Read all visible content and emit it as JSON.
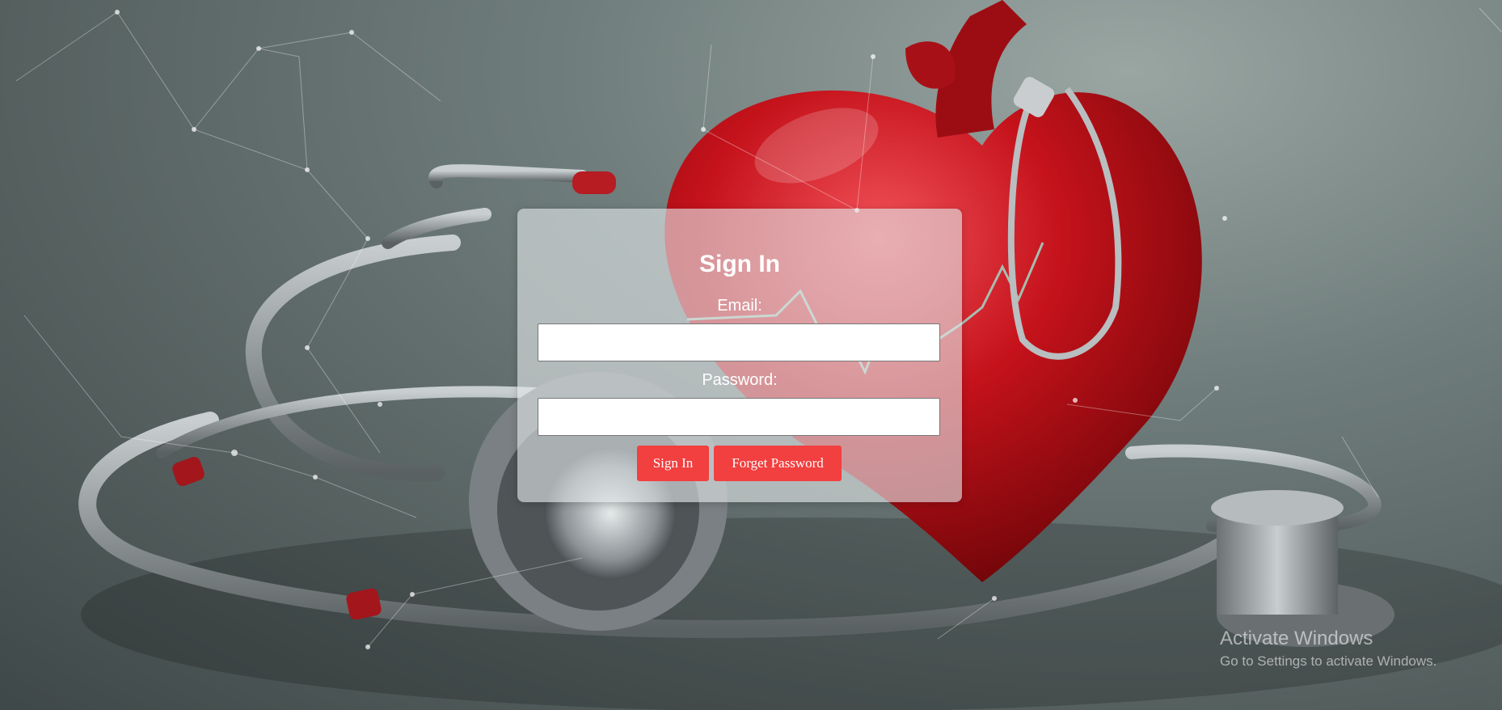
{
  "background": {
    "description_icon": "heart-stethoscope-illustration",
    "colors": {
      "bg": "#5e6a6a",
      "heart": "#c4121a",
      "tube": "#8a9294"
    }
  },
  "form": {
    "title": "Sign In",
    "email_label": "Email:",
    "email_value": "",
    "password_label": "Password:",
    "password_value": "",
    "signin_label": "Sign In",
    "forget_label": "Forget Password",
    "button_color": "#f23f3f"
  },
  "watermark": {
    "line1": "Activate Windows",
    "line2": "Go to Settings to activate Windows."
  }
}
